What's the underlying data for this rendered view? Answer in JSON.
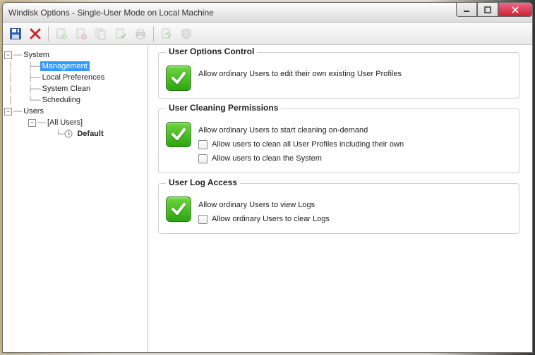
{
  "title": "Windisk  Options - Single-User Mode on Local Machine",
  "tree": {
    "system": "System",
    "management": "Management",
    "localpref": "Local Preferences",
    "sysclean": "System Clean",
    "scheduling": "Scheduling",
    "users": "Users",
    "allusers": "[All Users]",
    "default": "Default"
  },
  "groups": {
    "optcontrol": {
      "title": "User Options Control",
      "main": "Allow ordinary Users to edit their own existing User Profiles"
    },
    "cleanperm": {
      "title": "User Cleaning Permissions",
      "main": "Allow ordinary Users to start cleaning on-demand",
      "sub1": "Allow users to clean all User Profiles including their own",
      "sub2": "Allow users to clean the System"
    },
    "logaccess": {
      "title": "User Log Access",
      "main": "Allow ordinary Users to view Logs",
      "sub1": "Allow ordinary Users to clear Logs"
    }
  }
}
